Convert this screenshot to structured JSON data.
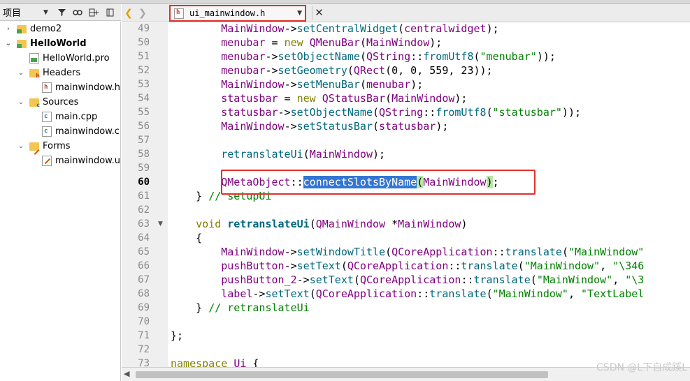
{
  "project_pane": {
    "title": "项目",
    "tree": [
      {
        "label": "demo2",
        "level": 0,
        "expanded": false,
        "icon": "project-folder-icon",
        "bold": false
      },
      {
        "label": "HelloWorld",
        "level": 0,
        "expanded": true,
        "icon": "project-folder-icon",
        "bold": true
      },
      {
        "label": "HelloWorld.pro",
        "level": 1,
        "expanded": null,
        "icon": "pro-file-icon",
        "bold": false
      },
      {
        "label": "Headers",
        "level": 1,
        "expanded": true,
        "icon": "headers-folder-icon",
        "bold": false
      },
      {
        "label": "mainwindow.h",
        "level": 2,
        "expanded": null,
        "icon": "header-file-icon",
        "bold": false
      },
      {
        "label": "Sources",
        "level": 1,
        "expanded": true,
        "icon": "sources-folder-icon",
        "bold": false
      },
      {
        "label": "main.cpp",
        "level": 2,
        "expanded": null,
        "icon": "cpp-file-icon",
        "bold": false
      },
      {
        "label": "mainwindow.cpp",
        "level": 2,
        "expanded": null,
        "icon": "cpp-file-icon",
        "bold": false
      },
      {
        "label": "Forms",
        "level": 1,
        "expanded": true,
        "icon": "forms-folder-icon",
        "bold": false
      },
      {
        "label": "mainwindow.ui",
        "level": 2,
        "expanded": null,
        "icon": "ui-file-icon",
        "bold": false
      }
    ]
  },
  "editor": {
    "tab_name": "ui_mainwindow.h",
    "current_line": 60,
    "lines": [
      {
        "n": 49,
        "fold": "",
        "tokens": [
          [
            "        ",
            ""
          ],
          [
            "MainWindow",
            "var"
          ],
          [
            "->",
            ""
          ],
          [
            "setCentralWidget",
            "fn"
          ],
          [
            "(",
            ""
          ],
          [
            "centralwidget",
            "var"
          ],
          [
            ");",
            ""
          ]
        ]
      },
      {
        "n": 50,
        "fold": "",
        "tokens": [
          [
            "        ",
            ""
          ],
          [
            "menubar",
            "var"
          ],
          [
            " = ",
            ""
          ],
          [
            "new",
            "kw"
          ],
          [
            " ",
            ""
          ],
          [
            "QMenuBar",
            "var"
          ],
          [
            "(",
            ""
          ],
          [
            "MainWindow",
            "var"
          ],
          [
            ");",
            ""
          ]
        ]
      },
      {
        "n": 51,
        "fold": "",
        "tokens": [
          [
            "        ",
            ""
          ],
          [
            "menubar",
            "var"
          ],
          [
            "->",
            ""
          ],
          [
            "setObjectName",
            "fn"
          ],
          [
            "(",
            ""
          ],
          [
            "QString",
            "var"
          ],
          [
            "::",
            ""
          ],
          [
            "fromUtf8",
            "fn"
          ],
          [
            "(",
            ""
          ],
          [
            "\"menubar\"",
            "str"
          ],
          [
            "));",
            ""
          ]
        ]
      },
      {
        "n": 52,
        "fold": "",
        "tokens": [
          [
            "        ",
            ""
          ],
          [
            "menubar",
            "var"
          ],
          [
            "->",
            ""
          ],
          [
            "setGeometry",
            "fn"
          ],
          [
            "(",
            ""
          ],
          [
            "QRect",
            "var"
          ],
          [
            "(0, 0, 559, 23));",
            ""
          ]
        ]
      },
      {
        "n": 53,
        "fold": "",
        "tokens": [
          [
            "        ",
            ""
          ],
          [
            "MainWindow",
            "var"
          ],
          [
            "->",
            ""
          ],
          [
            "setMenuBar",
            "fn"
          ],
          [
            "(",
            ""
          ],
          [
            "menubar",
            "var"
          ],
          [
            ");",
            ""
          ]
        ]
      },
      {
        "n": 54,
        "fold": "",
        "tokens": [
          [
            "        ",
            ""
          ],
          [
            "statusbar",
            "var"
          ],
          [
            " = ",
            ""
          ],
          [
            "new",
            "kw"
          ],
          [
            " ",
            ""
          ],
          [
            "QStatusBar",
            "var"
          ],
          [
            "(",
            ""
          ],
          [
            "MainWindow",
            "var"
          ],
          [
            ");",
            ""
          ]
        ]
      },
      {
        "n": 55,
        "fold": "",
        "tokens": [
          [
            "        ",
            ""
          ],
          [
            "statusbar",
            "var"
          ],
          [
            "->",
            ""
          ],
          [
            "setObjectName",
            "fn"
          ],
          [
            "(",
            ""
          ],
          [
            "QString",
            "var"
          ],
          [
            "::",
            ""
          ],
          [
            "fromUtf8",
            "fn"
          ],
          [
            "(",
            ""
          ],
          [
            "\"statusbar\"",
            "str"
          ],
          [
            "));",
            ""
          ]
        ]
      },
      {
        "n": 56,
        "fold": "",
        "tokens": [
          [
            "        ",
            ""
          ],
          [
            "MainWindow",
            "var"
          ],
          [
            "->",
            ""
          ],
          [
            "setStatusBar",
            "fn"
          ],
          [
            "(",
            ""
          ],
          [
            "statusbar",
            "var"
          ],
          [
            ");",
            ""
          ]
        ]
      },
      {
        "n": 57,
        "fold": "",
        "tokens": [
          [
            "",
            ""
          ]
        ]
      },
      {
        "n": 58,
        "fold": "",
        "tokens": [
          [
            "        ",
            ""
          ],
          [
            "retranslateUi",
            "fn"
          ],
          [
            "(",
            ""
          ],
          [
            "MainWindow",
            "var"
          ],
          [
            ");",
            ""
          ]
        ]
      },
      {
        "n": 59,
        "fold": "",
        "tokens": [
          [
            "",
            ""
          ]
        ]
      },
      {
        "n": 60,
        "fold": "",
        "tokens": [
          [
            "        ",
            ""
          ],
          [
            "QMetaObject",
            "var"
          ],
          [
            "::",
            ""
          ],
          [
            "connectSlotsByName",
            "sel"
          ],
          [
            "(",
            "paren"
          ],
          [
            "MainWindow",
            "var"
          ],
          [
            ")",
            "paren"
          ],
          [
            ";",
            ""
          ]
        ]
      },
      {
        "n": 61,
        "fold": "",
        "tokens": [
          [
            "    } ",
            ""
          ],
          [
            "// setupUi",
            "cm"
          ]
        ]
      },
      {
        "n": 62,
        "fold": "",
        "tokens": [
          [
            "",
            ""
          ]
        ]
      },
      {
        "n": 63,
        "fold": "▼",
        "tokens": [
          [
            "    ",
            ""
          ],
          [
            "void",
            "kw"
          ],
          [
            " ",
            ""
          ],
          [
            "retranslateUi",
            "bold"
          ],
          [
            "(",
            ""
          ],
          [
            "QMainWindow",
            "var"
          ],
          [
            " *",
            ""
          ],
          [
            "MainWindow",
            "var"
          ],
          [
            ")",
            ""
          ]
        ]
      },
      {
        "n": 64,
        "fold": "",
        "tokens": [
          [
            "    {",
            ""
          ]
        ]
      },
      {
        "n": 65,
        "fold": "",
        "tokens": [
          [
            "        ",
            ""
          ],
          [
            "MainWindow",
            "var"
          ],
          [
            "->",
            ""
          ],
          [
            "setWindowTitle",
            "fn"
          ],
          [
            "(",
            ""
          ],
          [
            "QCoreApplication",
            "var"
          ],
          [
            "::",
            ""
          ],
          [
            "translate",
            "fn"
          ],
          [
            "(",
            ""
          ],
          [
            "\"MainWindow\"",
            "str"
          ]
        ]
      },
      {
        "n": 66,
        "fold": "",
        "tokens": [
          [
            "        ",
            ""
          ],
          [
            "pushButton",
            "var"
          ],
          [
            "->",
            ""
          ],
          [
            "setText",
            "fn"
          ],
          [
            "(",
            ""
          ],
          [
            "QCoreApplication",
            "var"
          ],
          [
            "::",
            ""
          ],
          [
            "translate",
            "fn"
          ],
          [
            "(",
            ""
          ],
          [
            "\"MainWindow\"",
            "str"
          ],
          [
            ", ",
            ""
          ],
          [
            "\"\\346",
            "str"
          ]
        ]
      },
      {
        "n": 67,
        "fold": "",
        "tokens": [
          [
            "        ",
            ""
          ],
          [
            "pushButton_2",
            "var"
          ],
          [
            "->",
            ""
          ],
          [
            "setText",
            "fn"
          ],
          [
            "(",
            ""
          ],
          [
            "QCoreApplication",
            "var"
          ],
          [
            "::",
            ""
          ],
          [
            "translate",
            "fn"
          ],
          [
            "(",
            ""
          ],
          [
            "\"MainWindow\"",
            "str"
          ],
          [
            ", ",
            ""
          ],
          [
            "\"\\3",
            "str"
          ]
        ]
      },
      {
        "n": 68,
        "fold": "",
        "tokens": [
          [
            "        ",
            ""
          ],
          [
            "label",
            "var"
          ],
          [
            "->",
            ""
          ],
          [
            "setText",
            "fn"
          ],
          [
            "(",
            ""
          ],
          [
            "QCoreApplication",
            "var"
          ],
          [
            "::",
            ""
          ],
          [
            "translate",
            "fn"
          ],
          [
            "(",
            ""
          ],
          [
            "\"MainWindow\"",
            "str"
          ],
          [
            ", ",
            ""
          ],
          [
            "\"TextLabel",
            "str"
          ]
        ]
      },
      {
        "n": 69,
        "fold": "",
        "tokens": [
          [
            "    } ",
            ""
          ],
          [
            "// retranslateUi",
            "cm"
          ]
        ]
      },
      {
        "n": 70,
        "fold": "",
        "tokens": [
          [
            "",
            ""
          ]
        ]
      },
      {
        "n": 71,
        "fold": "",
        "tokens": [
          [
            "};",
            ""
          ]
        ]
      },
      {
        "n": 72,
        "fold": "",
        "tokens": [
          [
            "",
            ""
          ]
        ]
      },
      {
        "n": 73,
        "fold": "",
        "tokens": [
          [
            "namespace",
            "kw"
          ],
          [
            " ",
            ""
          ],
          [
            "Ui",
            "ns"
          ],
          [
            " {",
            ""
          ]
        ]
      }
    ]
  },
  "watermark": "CSDN @L下自成蹊L",
  "colors": {
    "highlight_border": "#e0302a",
    "selection": "#3476d3"
  }
}
